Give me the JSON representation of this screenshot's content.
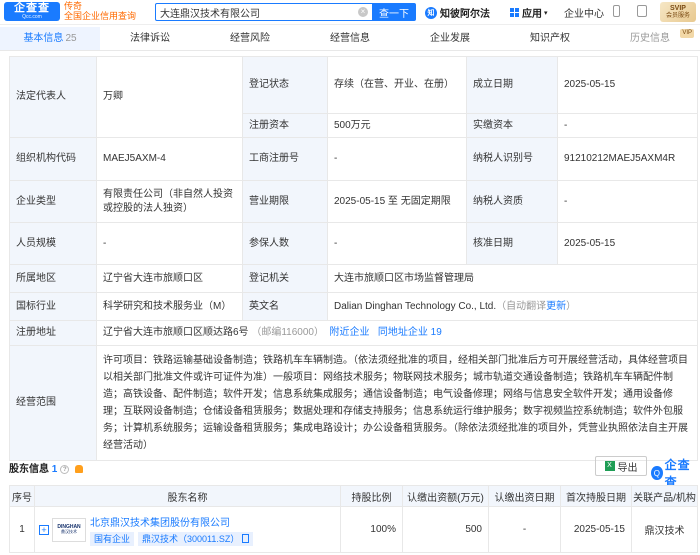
{
  "header": {
    "logo_text": "企查查",
    "logo_sub": "Qcc.com",
    "slogan_line1": "传奇",
    "slogan_line2": "全国企业信用查询",
    "search_value": "大连鼎汉技术有限公司",
    "search_button": "查一下",
    "law_link": "知彼阿尔法",
    "apps_label": "应用",
    "enterprise_center": "企业中心",
    "vip_line1": "SVIP",
    "vip_line2": "会员服务",
    "colors": {
      "brand": "#1a7bff",
      "accent_orange": "#ff6a00"
    },
    "icons": [
      "clear-icon",
      "law-icon",
      "apps-grid-icon",
      "phone-icon",
      "message-icon"
    ]
  },
  "tabs": [
    {
      "label": "基本信息",
      "count": "25"
    },
    {
      "label": "法律诉讼",
      "count": ""
    },
    {
      "label": "经营风险",
      "count": ""
    },
    {
      "label": "经营信息",
      "count": ""
    },
    {
      "label": "企业发展",
      "count": ""
    },
    {
      "label": "知识产权",
      "count": ""
    },
    {
      "label": "历史信息",
      "count": "",
      "badge": "VIP"
    }
  ],
  "info": {
    "legal_rep": {
      "label": "法定代表人",
      "value": "万卿"
    },
    "reg_status": {
      "label": "登记状态",
      "value": "存续（在营、开业、在册）"
    },
    "founded": {
      "label": "成立日期",
      "value": "2025-05-15"
    },
    "reg_capital": {
      "label": "注册资本",
      "value": "500万元"
    },
    "paid_capital": {
      "label": "实缴资本",
      "value": "-"
    },
    "org_code": {
      "label": "组织机构代码",
      "value": "MAEJ5AXM-4"
    },
    "biz_reg_no": {
      "label": "工商注册号",
      "value": "-"
    },
    "taxpayer_id": {
      "label": "纳税人识别号",
      "value": "91210212MAEJ5AXM4R"
    },
    "company_type": {
      "label": "企业类型",
      "value": "有限责任公司（非自然人投资或控股的法人独资）"
    },
    "biz_term": {
      "label": "营业期限",
      "value": "2025-05-15 至 无固定期限"
    },
    "taxpayer_qual": {
      "label": "纳税人资质",
      "value": "-"
    },
    "staff_size": {
      "label": "人员规模",
      "value": "-"
    },
    "insured": {
      "label": "参保人数",
      "value": "-"
    },
    "approval_date": {
      "label": "核准日期",
      "value": "2025-05-15"
    },
    "region": {
      "label": "所属地区",
      "value": "辽宁省大连市旅顺口区"
    },
    "reg_authority": {
      "label": "登记机关",
      "value": "大连市旅顺口区市场监督管理局"
    },
    "industry": {
      "label": "国标行业",
      "value": "科学研究和技术服务业（M）"
    },
    "english_name": {
      "label": "英文名",
      "value": "Dalian Dinghan Technology Co., Ltd.",
      "note": "（自动翻译",
      "update": "更新",
      "close": "）"
    },
    "address": {
      "label": "注册地址",
      "value": "辽宁省大连市旅顺口区顺达路6号",
      "postcode": "（邮编116000）",
      "nearby": "附近企业",
      "same_addr": "同地址企业 19"
    },
    "scope": {
      "label": "经营范围",
      "value": "许可项目：铁路运输基础设备制造；铁路机车车辆制造。（依法须经批准的项目，经相关部门批准后方可开展经营活动，具体经营项目以相关部门批准文件或许可证件为准）一般项目：网络技术服务；物联网技术服务；城市轨道交通设备制造；铁路机车车辆配件制造；高铁设备、配件制造；软件开发；信息系统集成服务；通信设备制造；电气设备修理；网络与信息安全软件开发；通用设备修理；互联网设备制造；仓储设备租赁服务；数据处理和存储支持服务；信息系统运行维护服务；数字视频监控系统制造；软件外包服务；计算机系统服务；运输设备租赁服务；集成电路设计；办公设备租赁服务。（除依法须经批准的项目外，凭营业执照依法自主开展经营活动）"
    }
  },
  "shareholders": {
    "title": "股东信息",
    "count": "1",
    "export_label": "导出",
    "watermark": "企查查",
    "columns": [
      "序号",
      "股东名称",
      "持股比例",
      "认缴出资额(万元)",
      "认缴出资日期",
      "首次持股日期",
      "关联产品/机构"
    ],
    "rows": [
      {
        "index": "1",
        "logo_text": "DINGHAN",
        "logo_sub": "鼎汉技术",
        "name": "北京鼎汉技术集团股份有限公司",
        "tag1": "国有企业",
        "tag2": "鼎汉技术（300011.SZ）",
        "ratio": "100%",
        "subscribed": "500",
        "subscribed_date": "-",
        "first_date": "2025-05-15",
        "related": "鼎汉技术"
      }
    ]
  }
}
